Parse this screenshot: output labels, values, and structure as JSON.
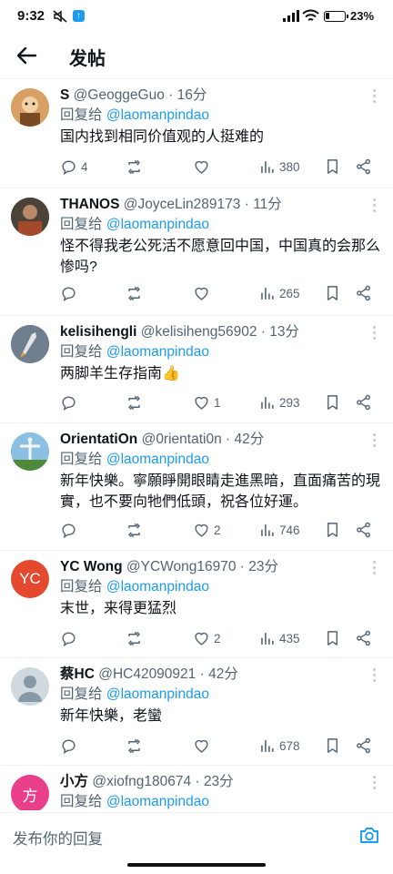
{
  "status_bar": {
    "time": "9:32",
    "battery_text": "23%",
    "battery_level": 0.23
  },
  "header": {
    "title": "发帖"
  },
  "replies": [
    {
      "name": "S",
      "handle": "@GeoggeGuo",
      "time": "16分",
      "reply_to_label": "回复给",
      "reply_to": "@laomanpindao",
      "text": "国内找到相同价值观的人挺难的",
      "replies_count": "4",
      "retweets": "",
      "likes": "",
      "views": "380",
      "avatar": "cartoon-avatar"
    },
    {
      "name": "THANOS",
      "handle": "@JoyceLin289173",
      "time": "11分",
      "reply_to_label": "回复给",
      "reply_to": "@laomanpindao",
      "text": "怪不得我老公死活不愿意回中国，中国真的会那么惨吗?",
      "replies_count": "",
      "retweets": "",
      "likes": "",
      "views": "265",
      "avatar": "photo-avatar"
    },
    {
      "name": "kelisihengli",
      "handle": "@kelisiheng56902",
      "time": "13分",
      "reply_to_label": "回复给",
      "reply_to": "@laomanpindao",
      "text": "两脚羊生存指南👍",
      "replies_count": "",
      "retweets": "",
      "likes": "1",
      "views": "293",
      "avatar": "rocket-avatar"
    },
    {
      "name": "OrientatiOn",
      "handle": "@0rientati0n",
      "time": "42分",
      "reply_to_label": "回复给",
      "reply_to": "@laomanpindao",
      "text": "新年快樂。寧願睜開眼睛走進黑暗，直面痛苦的現實，也不要向牠們低頭，祝各位好運。",
      "replies_count": "",
      "retweets": "",
      "likes": "2",
      "views": "746",
      "avatar": "statue-avatar"
    },
    {
      "name": "YC Wong",
      "handle": "@YCWong16970",
      "time": "23分",
      "reply_to_label": "回复给",
      "reply_to": "@laomanpindao",
      "text": "末世，来得更猛烈",
      "replies_count": "",
      "retweets": "",
      "likes": "2",
      "views": "435",
      "avatar_letter": "YC",
      "avatar_color": "#e2492f"
    },
    {
      "name": "蔡HC",
      "handle": "@HC42090921",
      "time": "42分",
      "reply_to_label": "回复给",
      "reply_to": "@laomanpindao",
      "text": "新年快樂，老蠻",
      "replies_count": "",
      "retweets": "",
      "likes": "",
      "views": "678",
      "avatar": "default-avatar"
    },
    {
      "name": "小方",
      "handle": "@xiofng180674",
      "time": "23分",
      "reply_to_label": "回复给",
      "reply_to": "@laomanpindao",
      "text": "",
      "avatar_letter": "方",
      "avatar_color": "#e93f8b"
    }
  ],
  "composer": {
    "placeholder": "发布你的回复"
  },
  "colors": {
    "accent": "#1d9bf0",
    "muted": "#536471",
    "text": "#0f1419",
    "divider": "#eff3f4"
  }
}
